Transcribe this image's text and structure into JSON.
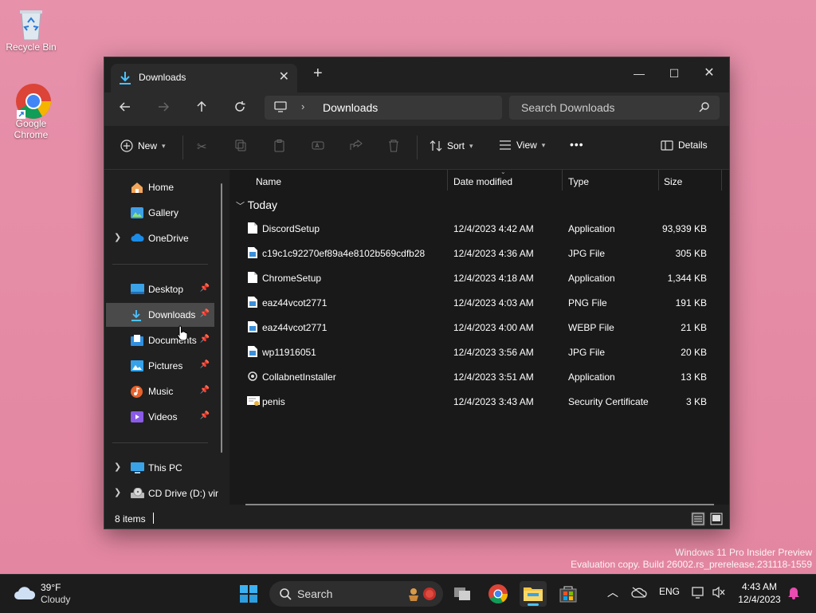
{
  "desktop": {
    "icons": [
      {
        "label": "Recycle Bin",
        "icon": "recycle-bin-icon"
      },
      {
        "label": "Google Chrome",
        "icon": "chrome-icon"
      }
    ],
    "watermark_line1": "Windows 11 Pro Insider Preview",
    "watermark_line2": "Evaluation copy. Build 26002.rs_prerelease.231118-1559"
  },
  "window": {
    "tab_title": "Downloads",
    "new_tab": "+",
    "controls": {
      "minimize": "—",
      "maximize": "☐",
      "close": "✕"
    },
    "address": {
      "location": "Downloads"
    },
    "search": {
      "placeholder": "Search Downloads"
    },
    "commands": {
      "new": "New",
      "sort": "Sort",
      "view": "View",
      "more": "•••",
      "details": "Details"
    },
    "nav": {
      "home": "Home",
      "gallery": "Gallery",
      "onedrive": "OneDrive",
      "desktop": "Desktop",
      "downloads": "Downloads",
      "documents": "Documents",
      "pictures": "Pictures",
      "music": "Music",
      "videos": "Videos",
      "thispc": "This PC",
      "cddrive": "CD Drive (D:) vir"
    },
    "columns": {
      "name": "Name",
      "date": "Date modified",
      "type": "Type",
      "size": "Size"
    },
    "group": "Today",
    "files": [
      {
        "name": "DiscordSetup",
        "date": "12/4/2023 4:42 AM",
        "type": "Application",
        "size": "93,939 KB",
        "icon": "application-file-icon"
      },
      {
        "name": "c19c1c92270ef89a4e8102b569cdfb28",
        "date": "12/4/2023 4:36 AM",
        "type": "JPG File",
        "size": "305 KB",
        "icon": "image-file-icon"
      },
      {
        "name": "ChromeSetup",
        "date": "12/4/2023 4:18 AM",
        "type": "Application",
        "size": "1,344 KB",
        "icon": "application-file-icon"
      },
      {
        "name": "eaz44vcot2771",
        "date": "12/4/2023 4:03 AM",
        "type": "PNG File",
        "size": "191 KB",
        "icon": "image-file-icon"
      },
      {
        "name": "eaz44vcot2771",
        "date": "12/4/2023 4:00 AM",
        "type": "WEBP File",
        "size": "21 KB",
        "icon": "image-file-icon"
      },
      {
        "name": "wp11916051",
        "date": "12/4/2023 3:56 AM",
        "type": "JPG File",
        "size": "20 KB",
        "icon": "image-file-icon"
      },
      {
        "name": "CollabnetInstaller",
        "date": "12/4/2023 3:51 AM",
        "type": "Application",
        "size": "13 KB",
        "icon": "installer-file-icon"
      },
      {
        "name": "penis",
        "date": "12/4/2023 3:43 AM",
        "type": "Security Certificate",
        "size": "3 KB",
        "icon": "certificate-file-icon"
      }
    ],
    "status": {
      "count": "8 items"
    }
  },
  "taskbar": {
    "weather": {
      "temp": "39°F",
      "condition": "Cloudy"
    },
    "search_placeholder": "Search",
    "tray": {
      "language": "ENG"
    },
    "clock": {
      "time": "4:43 AM",
      "date": "12/4/2023"
    }
  },
  "colors": {
    "accent": "#4cc2ff",
    "folder": "#f4c542",
    "selection": "#4a4a4a"
  }
}
